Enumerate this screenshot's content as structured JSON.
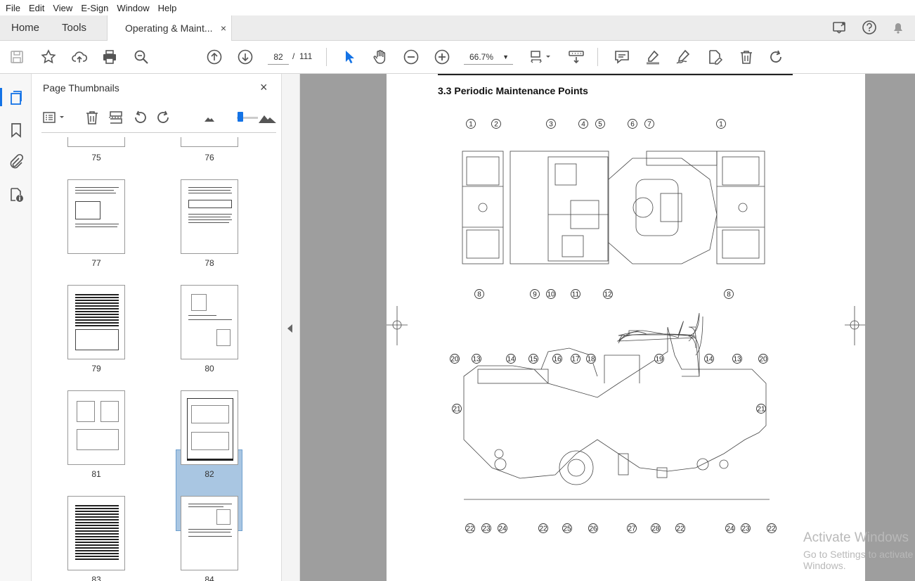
{
  "menu": [
    "File",
    "Edit",
    "View",
    "E-Sign",
    "Window",
    "Help"
  ],
  "tabs": {
    "home": "Home",
    "tools": "Tools",
    "document": "Operating & Maint...",
    "close": "×"
  },
  "toolbar": {
    "current_page": "82",
    "page_separator": "/",
    "total_pages": "111",
    "zoom": "66.7%",
    "zoom_arrow": "▼"
  },
  "panel": {
    "title": "Page Thumbnails",
    "close": "×",
    "thumbnails": [
      {
        "label": "75"
      },
      {
        "label": "76"
      },
      {
        "label": "77"
      },
      {
        "label": "78"
      },
      {
        "label": "79"
      },
      {
        "label": "80"
      },
      {
        "label": "81"
      },
      {
        "label": "82"
      },
      {
        "label": "83"
      },
      {
        "label": "84"
      }
    ],
    "selected": "82"
  },
  "document": {
    "section_title": "3.3  Periodic Maintenance Points",
    "top_callouts": [
      "1",
      "2",
      "3",
      "4",
      "5",
      "6",
      "7",
      "1",
      "8",
      "9",
      "10",
      "11",
      "12",
      "8"
    ],
    "side_callouts": [
      "20",
      "13",
      "14",
      "15",
      "16",
      "17",
      "18",
      "19",
      "14",
      "13",
      "20",
      "21",
      "21",
      "22",
      "23",
      "24",
      "22",
      "25",
      "26",
      "27",
      "28",
      "22",
      "24",
      "23",
      "22"
    ]
  },
  "watermark": {
    "line1": "Activate Windows",
    "line2": "Go to Settings to activate Windows."
  },
  "colors": {
    "accent": "#1473e6",
    "selection": "#a9c6e2",
    "doc_bg": "#9e9e9e"
  }
}
